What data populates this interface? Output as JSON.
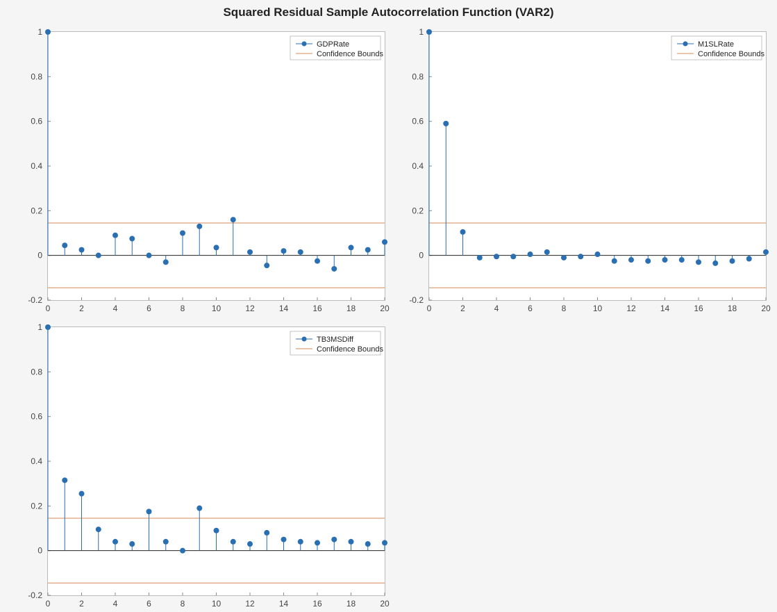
{
  "title": "Squared Residual Sample Autocorrelation Function (VAR2)",
  "panels": [
    {
      "series": "GDPRate",
      "legend": [
        "GDPRate",
        "Confidence Bounds"
      ]
    },
    {
      "series": "M1SLRate",
      "legend": [
        "M1SLRate",
        "Confidence Bounds"
      ]
    },
    {
      "series": "TB3MSDiff",
      "legend": [
        "TB3MSDiff",
        "Confidence Bounds"
      ]
    }
  ],
  "colors": {
    "stem": "#2a6fb1",
    "bounds": "#d78a5a",
    "axis": "#666",
    "baseline": "#000"
  },
  "chart_data": [
    {
      "type": "bar",
      "title": "GDPRate",
      "xlabel": "",
      "ylabel": "",
      "xlim": [
        0,
        20
      ],
      "ylim": [
        -0.2,
        1.0
      ],
      "xticks": [
        0,
        2,
        4,
        6,
        8,
        10,
        12,
        14,
        16,
        18,
        20
      ],
      "yticks": [
        -0.2,
        0,
        0.2,
        0.4,
        0.6,
        0.8,
        1.0
      ],
      "bounds": [
        0.145,
        -0.145
      ],
      "lags": [
        0,
        1,
        2,
        3,
        4,
        5,
        6,
        7,
        8,
        9,
        10,
        11,
        12,
        13,
        14,
        15,
        16,
        17,
        18,
        19,
        20
      ],
      "values": [
        1.0,
        0.045,
        0.025,
        0.0,
        0.09,
        0.075,
        0.0,
        -0.03,
        0.1,
        0.13,
        0.035,
        0.16,
        0.015,
        -0.045,
        0.02,
        0.015,
        -0.025,
        -0.06,
        0.035,
        0.025,
        0.06
      ],
      "legend": [
        "GDPRate",
        "Confidence Bounds"
      ]
    },
    {
      "type": "bar",
      "title": "M1SLRate",
      "xlabel": "",
      "ylabel": "",
      "xlim": [
        0,
        20
      ],
      "ylim": [
        -0.2,
        1.0
      ],
      "xticks": [
        0,
        2,
        4,
        6,
        8,
        10,
        12,
        14,
        16,
        18,
        20
      ],
      "yticks": [
        -0.2,
        0,
        0.2,
        0.4,
        0.6,
        0.8,
        1.0
      ],
      "bounds": [
        0.145,
        -0.145
      ],
      "lags": [
        0,
        1,
        2,
        3,
        4,
        5,
        6,
        7,
        8,
        9,
        10,
        11,
        12,
        13,
        14,
        15,
        16,
        17,
        18,
        19,
        20
      ],
      "values": [
        1.0,
        0.59,
        0.105,
        -0.01,
        -0.005,
        -0.005,
        0.005,
        0.015,
        -0.01,
        -0.005,
        0.005,
        -0.025,
        -0.02,
        -0.025,
        -0.02,
        -0.02,
        -0.03,
        -0.035,
        -0.025,
        -0.015,
        0.015
      ],
      "legend": [
        "M1SLRate",
        "Confidence Bounds"
      ]
    },
    {
      "type": "bar",
      "title": "TB3MSDiff",
      "xlabel": "",
      "ylabel": "",
      "xlim": [
        0,
        20
      ],
      "ylim": [
        -0.2,
        1.0
      ],
      "xticks": [
        0,
        2,
        4,
        6,
        8,
        10,
        12,
        14,
        16,
        18,
        20
      ],
      "yticks": [
        -0.2,
        0,
        0.2,
        0.4,
        0.6,
        0.8,
        1.0
      ],
      "bounds": [
        0.145,
        -0.145
      ],
      "lags": [
        0,
        1,
        2,
        3,
        4,
        5,
        6,
        7,
        8,
        9,
        10,
        11,
        12,
        13,
        14,
        15,
        16,
        17,
        18,
        19,
        20
      ],
      "values": [
        1.0,
        0.315,
        0.255,
        0.095,
        0.04,
        0.03,
        0.175,
        0.04,
        0.0,
        0.19,
        0.09,
        0.04,
        0.03,
        0.08,
        0.05,
        0.04,
        0.035,
        0.05,
        0.04,
        0.03,
        0.035
      ],
      "legend": [
        "TB3MSDiff",
        "Confidence Bounds"
      ]
    }
  ]
}
